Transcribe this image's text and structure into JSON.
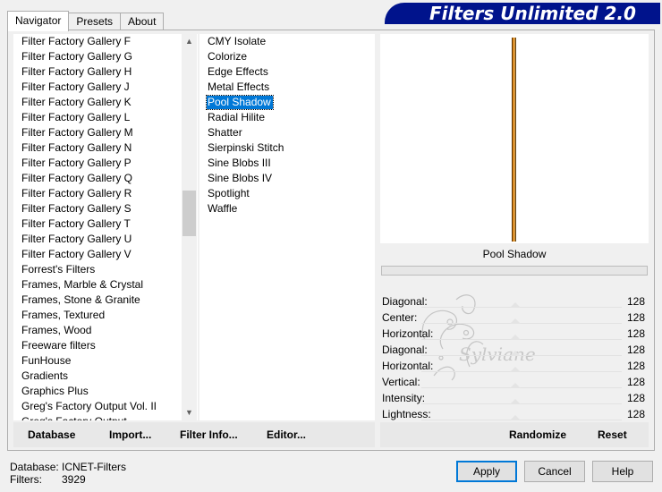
{
  "tabs": [
    {
      "label": "Navigator"
    },
    {
      "label": "Presets"
    },
    {
      "label": "About"
    }
  ],
  "banner": {
    "title": "Filters Unlimited 2.0"
  },
  "categories": [
    "Filter Factory Gallery F",
    "Filter Factory Gallery G",
    "Filter Factory Gallery H",
    "Filter Factory Gallery J",
    "Filter Factory Gallery K",
    "Filter Factory Gallery L",
    "Filter Factory Gallery M",
    "Filter Factory Gallery N",
    "Filter Factory Gallery P",
    "Filter Factory Gallery Q",
    "Filter Factory Gallery R",
    "Filter Factory Gallery S",
    "Filter Factory Gallery T",
    "Filter Factory Gallery U",
    "Filter Factory Gallery V",
    "Forrest's Filters",
    "Frames, Marble & Crystal",
    "Frames, Stone & Granite",
    "Frames, Textured",
    "Frames, Wood",
    "Freeware filters",
    "FunHouse",
    "Gradients",
    "Graphics Plus",
    "Greg's Factory Output Vol. II",
    "Greg's Factory Output"
  ],
  "filters": [
    "CMY Isolate",
    "Colorize",
    "Edge Effects",
    "Metal Effects",
    "Pool Shadow",
    "Radial Hilite",
    "Shatter",
    "Sierpinski Stitch",
    "Sine Blobs III",
    "Sine Blobs IV",
    "Spotlight",
    "Waffle"
  ],
  "selected_filter": "Pool Shadow",
  "watermark": {
    "text": "Sylviane"
  },
  "preview": {
    "filter_name": "Pool Shadow"
  },
  "parameters": [
    {
      "label": "Diagonal:",
      "value": "128"
    },
    {
      "label": "Center:",
      "value": "128"
    },
    {
      "label": "Horizontal:",
      "value": "128"
    },
    {
      "label": "Diagonal:",
      "value": "128"
    },
    {
      "label": "Horizontal:",
      "value": "128"
    },
    {
      "label": "Vertical:",
      "value": "128"
    },
    {
      "label": "Intensity:",
      "value": "128"
    },
    {
      "label": "Lightness:",
      "value": "128"
    }
  ],
  "left_buttons": {
    "database": "Database",
    "import": "Import...",
    "filter_info": "Filter Info...",
    "editor": "Editor..."
  },
  "right_buttons": {
    "randomize": "Randomize",
    "reset": "Reset"
  },
  "footer": {
    "database_label": "Database:",
    "database_value": "ICNET-Filters",
    "filters_label": "Filters:",
    "filters_value": "3929"
  },
  "dialog_buttons": {
    "apply": "Apply",
    "cancel": "Cancel",
    "help": "Help"
  }
}
